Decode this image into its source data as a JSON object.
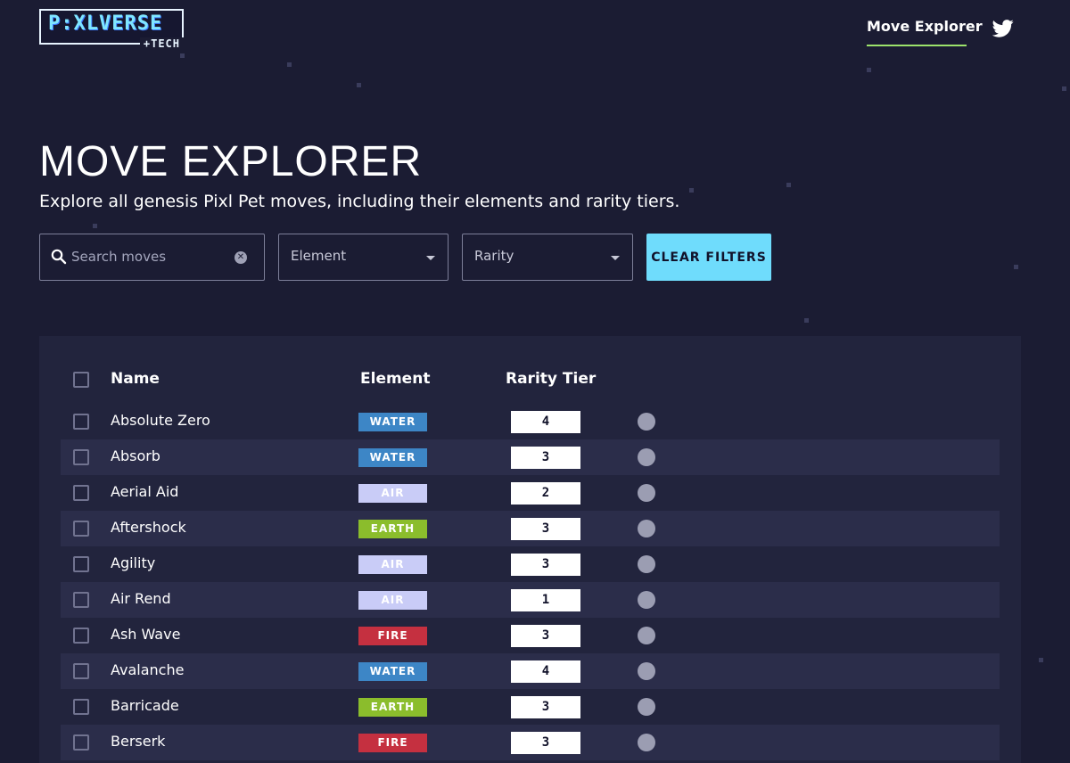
{
  "header": {
    "logo_main": "P:XLVERSE",
    "logo_sub": "+TECH",
    "nav_link": "Move Explorer"
  },
  "hero": {
    "title": "MOVE EXPLORER",
    "subtitle": "Explore all genesis Pixl Pet moves, including their elements and rarity tiers."
  },
  "filters": {
    "search_placeholder": "Search moves",
    "clear_icon": "✕",
    "element_label": "Element",
    "rarity_label": "Rarity",
    "clear_button": "CLEAR FILTERS"
  },
  "table": {
    "columns": [
      "Name",
      "Element",
      "Rarity Tier"
    ],
    "rows": [
      {
        "name": "Absolute Zero",
        "element": "WATER",
        "rarity": "4"
      },
      {
        "name": "Absorb",
        "element": "WATER",
        "rarity": "3"
      },
      {
        "name": "Aerial Aid",
        "element": "AIR",
        "rarity": "2"
      },
      {
        "name": "Aftershock",
        "element": "EARTH",
        "rarity": "3"
      },
      {
        "name": "Agility",
        "element": "AIR",
        "rarity": "3"
      },
      {
        "name": "Air Rend",
        "element": "AIR",
        "rarity": "1"
      },
      {
        "name": "Ash Wave",
        "element": "FIRE",
        "rarity": "3"
      },
      {
        "name": "Avalanche",
        "element": "WATER",
        "rarity": "4"
      },
      {
        "name": "Barricade",
        "element": "EARTH",
        "rarity": "3"
      },
      {
        "name": "Berserk",
        "element": "FIRE",
        "rarity": "3"
      }
    ]
  },
  "element_colors": {
    "WATER": "#3d86c6",
    "AIR": "#c9ccf7",
    "EARTH": "#8bbd2c",
    "FIRE": "#c53040"
  },
  "icons": {
    "search": "search-icon",
    "clear": "clear-icon",
    "dropdown": "chevron-down-icon",
    "twitter": "twitter-icon",
    "row_link": "opensea-icon"
  },
  "colors": {
    "background": "#1b1c33",
    "panel": "#22243d",
    "row_alt": "#2b2d4a",
    "accent_button": "#6fdcfc",
    "nav_underline": "#9ce36b"
  }
}
